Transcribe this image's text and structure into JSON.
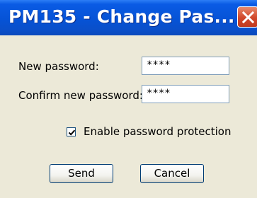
{
  "window": {
    "title": "PM135 - Change Pas...",
    "close_icon": "close-icon"
  },
  "form": {
    "new_password_label": "New password:",
    "new_password_value": "****",
    "confirm_password_label": "Confirm new password:",
    "confirm_password_value": "****",
    "enable_protection_label": "Enable password protection",
    "enable_protection_checked": true
  },
  "buttons": {
    "send_label": "Send",
    "cancel_label": "Cancel"
  },
  "colors": {
    "titlebar": "#0653d6",
    "dialog_bg": "#ece9d8",
    "close_button": "#d0472a"
  }
}
